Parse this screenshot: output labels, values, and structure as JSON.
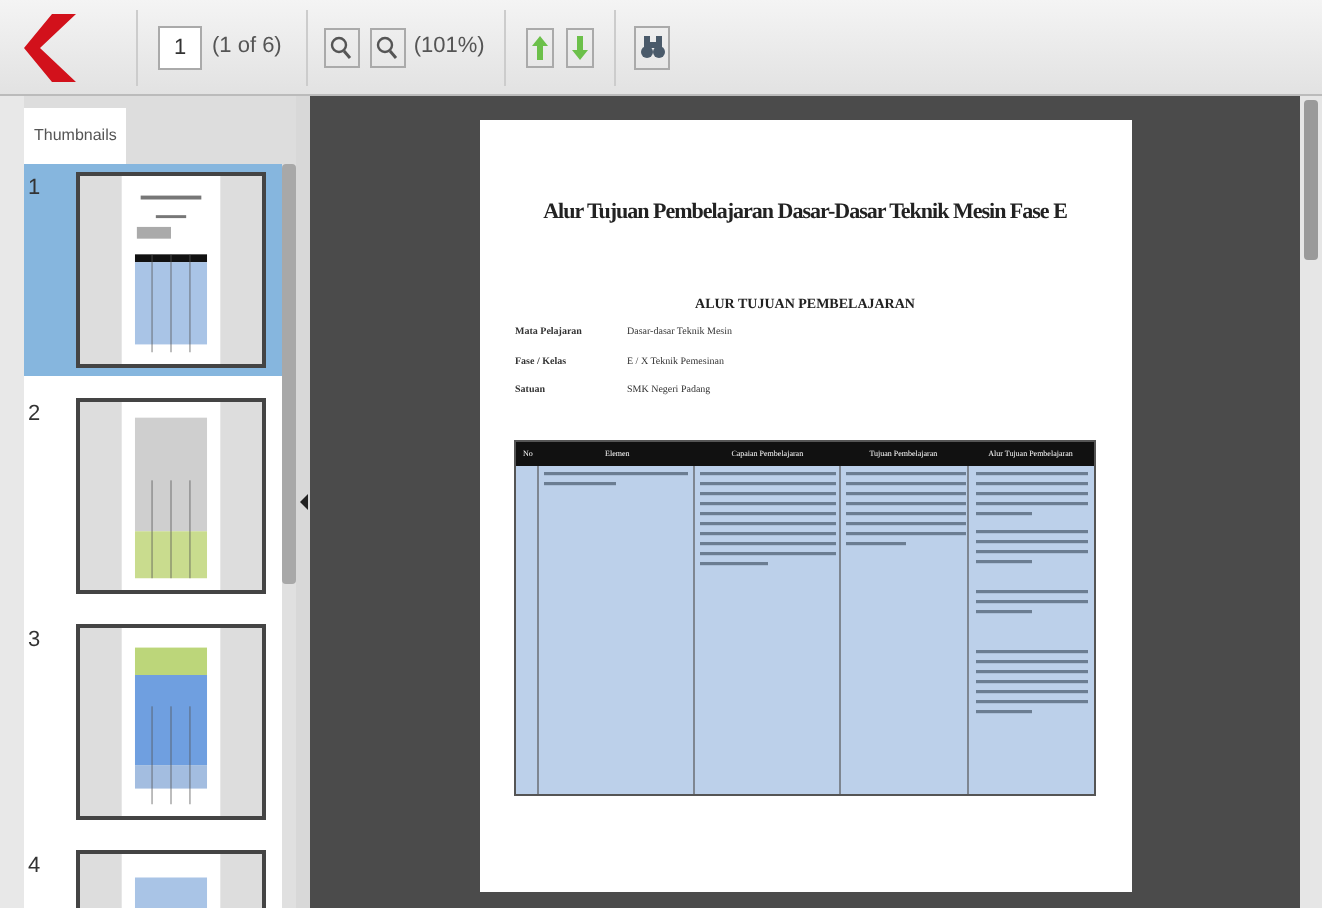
{
  "toolbar": {
    "page_number": "1",
    "page_count": "(1 of 6)",
    "zoom": "(101%)"
  },
  "sidebar": {
    "tabs": [
      {
        "label": "Thumbnails",
        "selected": true
      }
    ],
    "thumbnails": [
      {
        "number": "1",
        "selected": true,
        "kind": "cover"
      },
      {
        "number": "2",
        "selected": false,
        "kind": "gray-green"
      },
      {
        "number": "3",
        "selected": false,
        "kind": "green-blue"
      },
      {
        "number": "4",
        "selected": false,
        "kind": "blue"
      }
    ]
  },
  "document": {
    "title": "Alur Tujuan Pembelajaran Dasar-Dasar Teknik Mesin Fase E",
    "heading": "ALUR TUJUAN PEMBELAJARAN",
    "fields": [
      {
        "label": "Mata Pelajaran",
        "value": "Dasar-dasar Teknik Mesin"
      },
      {
        "label": "Fase / Kelas",
        "value": "E / X Teknik Pemesinan"
      },
      {
        "label": "Satuan",
        "value": "SMK Negeri Padang"
      }
    ],
    "table": {
      "columns": [
        "No",
        "Elemen",
        "Capaian Pembelajaran",
        "Tujuan Pembelajaran",
        "Alur Tujuan Pembelajaran"
      ]
    }
  }
}
